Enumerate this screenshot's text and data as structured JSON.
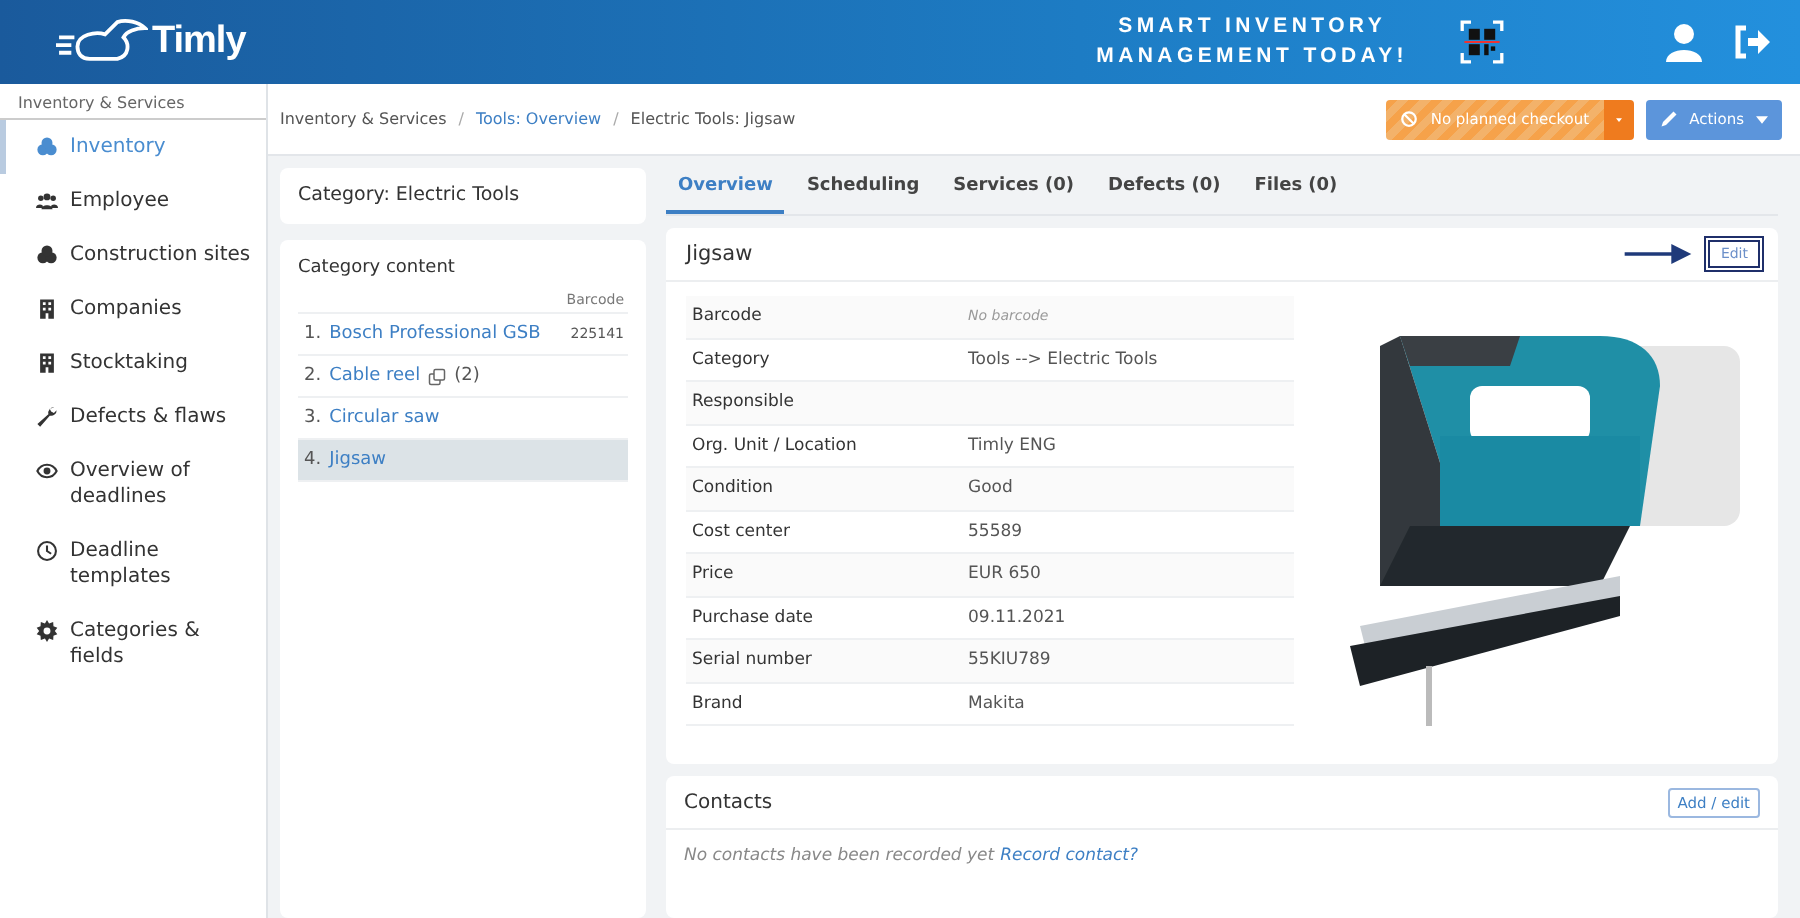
{
  "header": {
    "logo": "Timly",
    "slogan": [
      "SMART INVENTORY",
      "MANAGEMENT TODAY!"
    ]
  },
  "sidebar": {
    "title": "Inventory & Services",
    "items": [
      {
        "label": "Inventory",
        "selected": true
      },
      {
        "label": "Employee",
        "selected": false
      },
      {
        "label": "Construction sites",
        "selected": false
      },
      {
        "label": "Companies",
        "selected": false
      },
      {
        "label": "Stocktaking",
        "selected": false
      },
      {
        "label": "Defects & flaws",
        "selected": false
      },
      {
        "label": "Overview of deadlines",
        "selected": false
      },
      {
        "label": "Deadline templates",
        "selected": false
      },
      {
        "label": "Categories & fields",
        "selected": false
      }
    ]
  },
  "breadcrumb": [
    {
      "kind": "crumb",
      "label": "Inventory & Services",
      "link": false
    },
    {
      "kind": "separator",
      "label": "/"
    },
    {
      "kind": "crumb",
      "label": "Tools: Overview",
      "link": true
    },
    {
      "kind": "separator",
      "label": "/"
    },
    {
      "kind": "crumb",
      "label": "Electric Tools: Jigsaw",
      "link": false
    }
  ],
  "checkout_button": "No planned checkout",
  "actions_button": "Actions",
  "category_title": "Category: Electric Tools",
  "category_content": {
    "title": "Category content",
    "barcode_header": "Barcode",
    "items": [
      {
        "number": "1.",
        "name": "Bosch Professional GSB",
        "barcode": "225141",
        "selected": false
      },
      {
        "number": "2.",
        "name": "Cable reel",
        "count": "(2)",
        "selected": false
      },
      {
        "number": "3.",
        "name": "Circular saw",
        "selected": false
      },
      {
        "number": "4.",
        "name": "Jigsaw",
        "selected": true
      }
    ]
  },
  "tabs": [
    {
      "label": "Overview",
      "selected": true
    },
    {
      "label": "Scheduling",
      "selected": false
    },
    {
      "label": "Services (0)",
      "selected": false
    },
    {
      "label": "Defects (0)",
      "selected": false
    },
    {
      "label": "Files (0)",
      "selected": false
    }
  ],
  "item": {
    "title": "Jigsaw",
    "edit_button": "Edit",
    "highlighted": true,
    "fields": [
      {
        "label": "Barcode",
        "value": "No barcode",
        "empty": true
      },
      {
        "label": "Category",
        "value": "Tools --> Electric Tools"
      },
      {
        "label": "Responsible"
      },
      {
        "label": "Org. Unit / Location",
        "value": "Timly ENG"
      },
      {
        "label": "Condition",
        "value": "Good"
      },
      {
        "label": "Cost center",
        "value": "55589"
      },
      {
        "label": "Price",
        "value": "EUR 650"
      },
      {
        "label": "Purchase date",
        "value": "09.11.2021"
      },
      {
        "label": "Serial number",
        "value": "55KIU789"
      },
      {
        "label": "Brand",
        "value": "Makita"
      }
    ]
  },
  "contacts": {
    "title": "Contacts",
    "button": "Add / edit",
    "message": "No contacts have been recorded yet",
    "link": "Record contact?"
  }
}
